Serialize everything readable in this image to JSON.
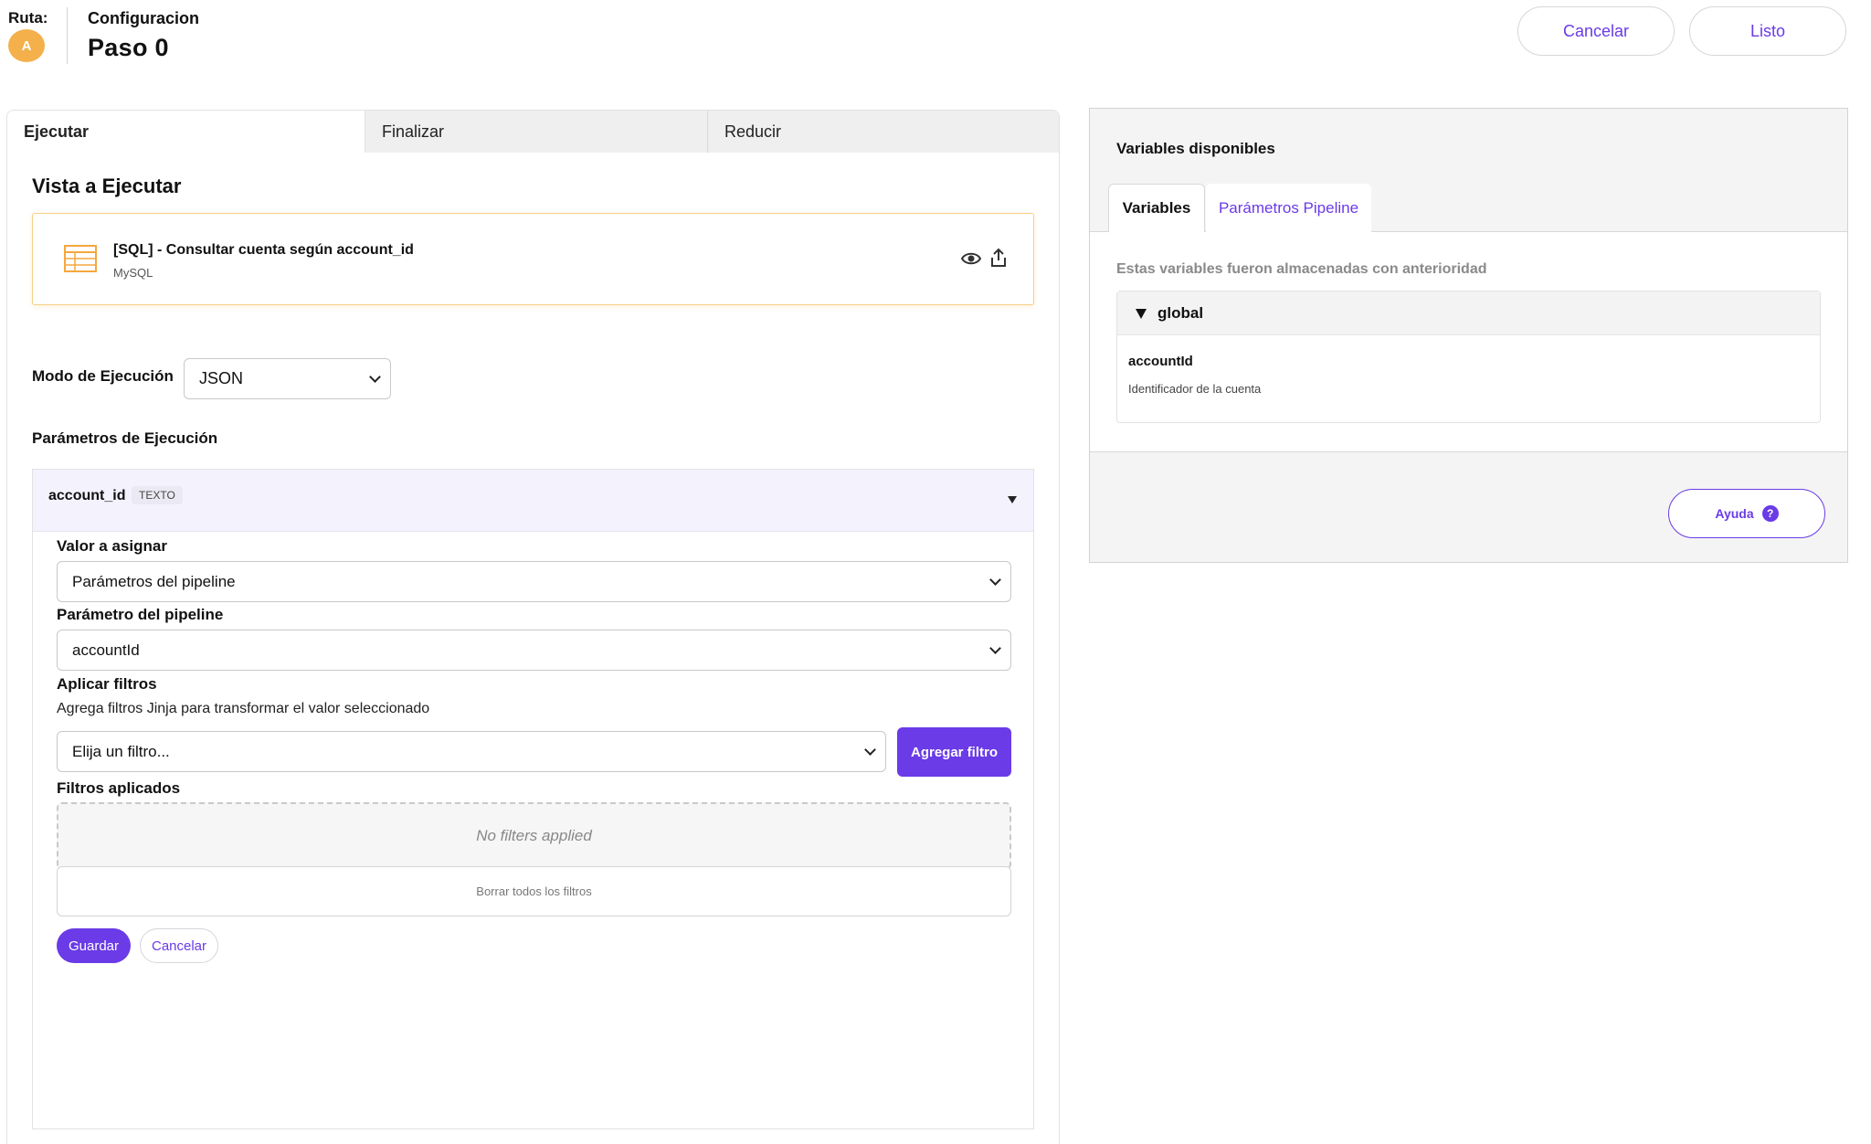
{
  "header": {
    "route_label": "Ruta:",
    "route_badge": "A",
    "step_subtitle": "Configuracion",
    "step_title": "Paso 0",
    "cancel_label": "Cancelar",
    "done_label": "Listo"
  },
  "tabs": [
    {
      "label": "Ejecutar",
      "active": true
    },
    {
      "label": "Finalizar",
      "active": false
    },
    {
      "label": "Reducir",
      "active": false
    }
  ],
  "execute": {
    "view_title": "Vista a Ejecutar",
    "query": {
      "name": "[SQL] - Consultar cuenta según account_id",
      "type": "MySQL",
      "icon": "table-icon"
    },
    "mode_label": "Modo de Ejecución",
    "mode_value": "JSON",
    "params_label": "Parámetros de Ejecución",
    "param": {
      "name": "account_id",
      "type": "TEXTO",
      "value_label": "Valor a asignar",
      "value_selected": "Parámetros del pipeline",
      "pipeline_param_label": "Parámetro del pipeline",
      "pipeline_param_selected": "accountId",
      "filters_label": "Aplicar filtros",
      "filters_desc": "Agrega filtros Jinja para transformar el valor seleccionado",
      "filter_placeholder": "Elija un filtro...",
      "add_filter_label": "Agregar filtro",
      "applied_label": "Filtros aplicados",
      "empty_text": "No filters applied",
      "clear_label": "Borrar todos los filtros",
      "save_label": "Guardar",
      "cancel_label": "Cancelar"
    }
  },
  "variables_panel": {
    "title": "Variables disponibles",
    "tabs": [
      {
        "label": "Variables",
        "active": true
      },
      {
        "label": "Parámetros Pipeline",
        "active": false
      }
    ],
    "hint": "Estas variables fueron almacenadas con anterioridad",
    "group": {
      "name": "global",
      "items": [
        {
          "name": "accountId",
          "description": "Identificador de la cuenta"
        }
      ]
    },
    "help_label": "Ayuda",
    "help_icon": "?"
  },
  "colors": {
    "accent": "#6a3be6",
    "badge": "#f4b04b",
    "card_border": "#f6cf85",
    "param_header_bg": "#f4f2fd"
  }
}
